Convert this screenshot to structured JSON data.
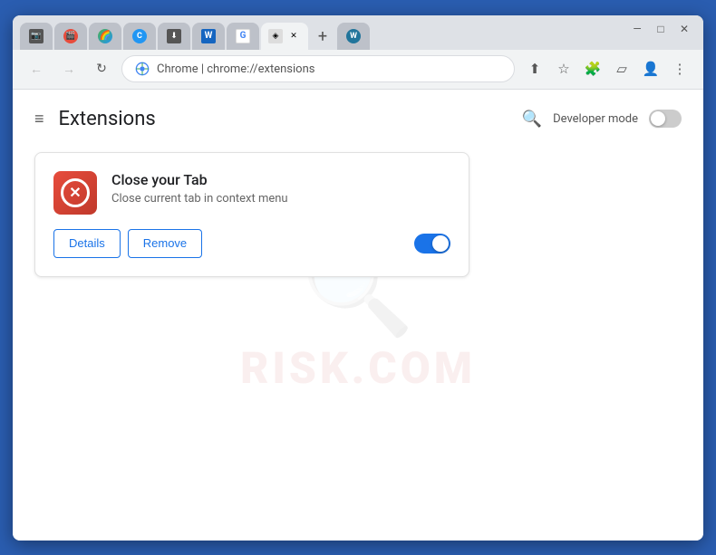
{
  "browser": {
    "title": "Extensions",
    "address": {
      "favicon_label": "Chrome",
      "url": "chrome://extensions",
      "display": "Chrome | chrome://extensions"
    },
    "window_controls": {
      "minimize": "—",
      "maximize": "□",
      "close": "✕",
      "chevron": "⌄"
    },
    "tabs": [
      {
        "id": "tab1",
        "favicon": "📷",
        "type": "camera",
        "active": false
      },
      {
        "id": "tab2",
        "favicon": "🎬",
        "type": "film",
        "active": false
      },
      {
        "id": "tab3",
        "favicon": "🌈",
        "type": "rainbow",
        "active": false
      },
      {
        "id": "tab4",
        "favicon": "C",
        "type": "c",
        "active": false
      },
      {
        "id": "tab5",
        "favicon": "⬇",
        "type": "dl",
        "active": false
      },
      {
        "id": "tab6",
        "favicon": "W",
        "type": "w",
        "active": false
      },
      {
        "id": "tab7",
        "favicon": "G",
        "type": "g",
        "active": false
      },
      {
        "id": "tab8",
        "favicon": "◈",
        "type": "ext",
        "active": true,
        "has_close": true
      },
      {
        "id": "tab9",
        "favicon": "W",
        "type": "wp",
        "active": false
      }
    ],
    "toolbar": {
      "back_label": "←",
      "forward_label": "→",
      "reload_label": "↻",
      "share_label": "⬆",
      "bookmark_label": "☆",
      "extensions_label": "🧩",
      "sidebar_label": "▱",
      "profile_label": "👤",
      "menu_label": "⋮"
    }
  },
  "extensions_page": {
    "hamburger_label": "≡",
    "title": "Extensions",
    "search_label": "🔍",
    "developer_mode_label": "Developer mode",
    "extension_card": {
      "icon_label": "✕",
      "name": "Close your Tab",
      "description": "Close current tab in context menu",
      "details_button": "Details",
      "remove_button": "Remove",
      "toggle_enabled": true
    }
  },
  "watermark": {
    "text": "RISK.COM"
  }
}
